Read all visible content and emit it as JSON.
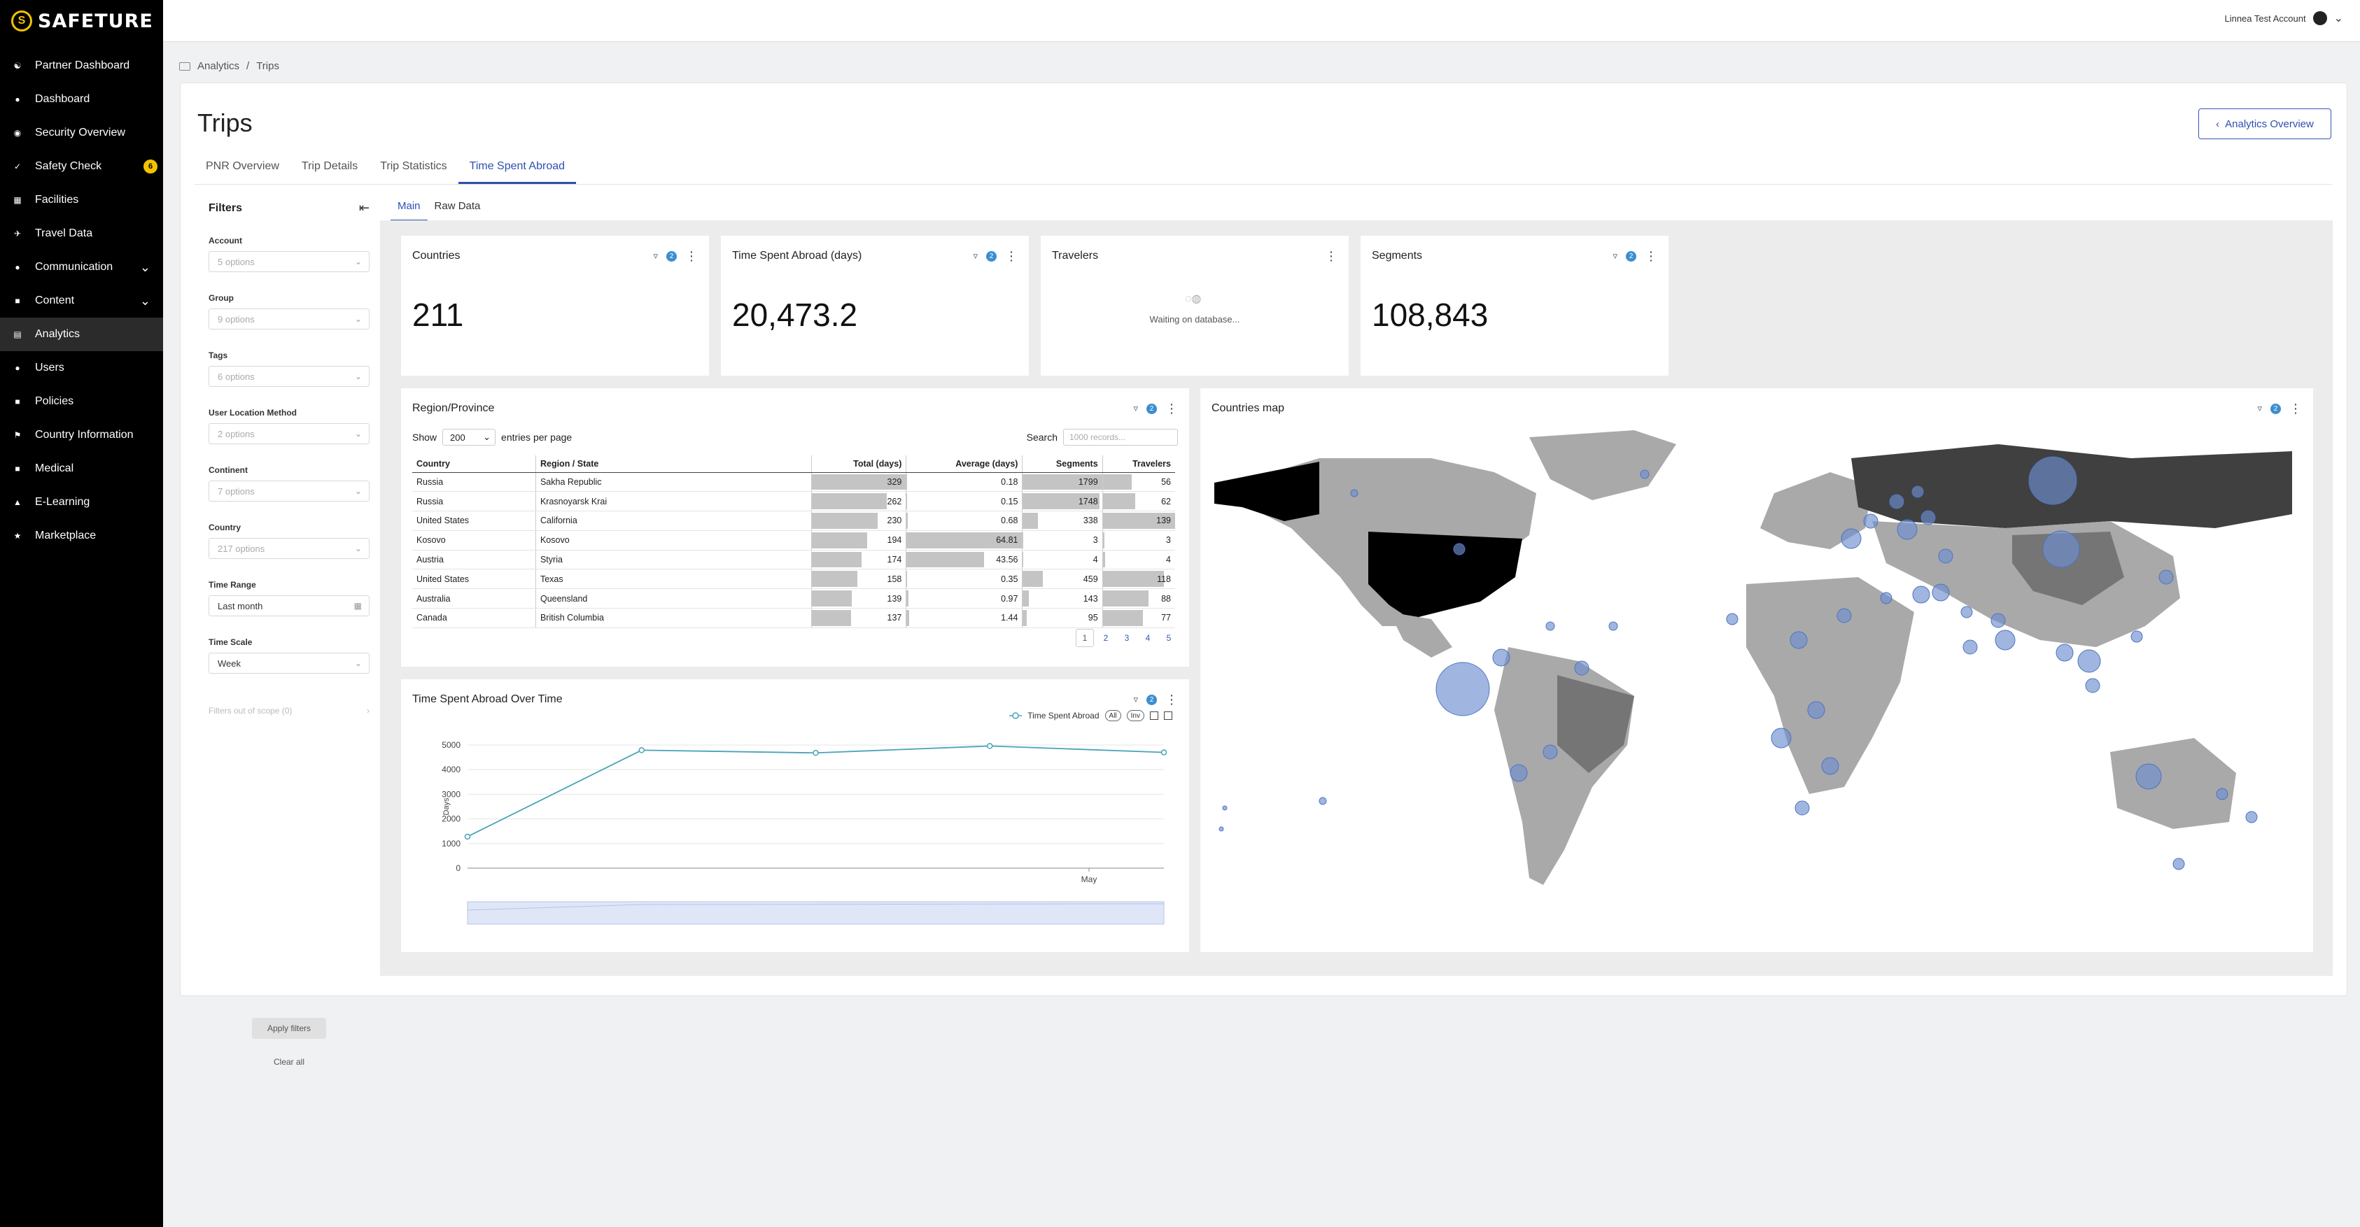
{
  "brand": {
    "name": "SAFETURE",
    "mark": "S"
  },
  "sidebar": {
    "items": [
      {
        "label": "Partner Dashboard",
        "icon": "handshake-icon"
      },
      {
        "label": "Dashboard",
        "icon": "dashboard-icon"
      },
      {
        "label": "Security Overview",
        "icon": "globe-icon"
      },
      {
        "label": "Safety Check",
        "icon": "check-icon",
        "badge": "6"
      },
      {
        "label": "Facilities",
        "icon": "building-icon"
      },
      {
        "label": "Travel Data",
        "icon": "plane-icon"
      },
      {
        "label": "Communication",
        "icon": "chat-icon",
        "expandable": true
      },
      {
        "label": "Content",
        "icon": "folder-icon",
        "expandable": true
      },
      {
        "label": "Analytics",
        "icon": "chart-icon",
        "active": true
      },
      {
        "label": "Users",
        "icon": "user-icon"
      },
      {
        "label": "Policies",
        "icon": "document-icon"
      },
      {
        "label": "Country Information",
        "icon": "flag-icon"
      },
      {
        "label": "Medical",
        "icon": "medical-icon"
      },
      {
        "label": "E-Learning",
        "icon": "graduation-icon"
      },
      {
        "label": "Marketplace",
        "icon": "store-icon"
      }
    ]
  },
  "topbar": {
    "account": "Linnea Test Account"
  },
  "breadcrumb": {
    "root": "Analytics",
    "sep": "/",
    "current": "Trips"
  },
  "page": {
    "title": "Trips",
    "overview_button": "Analytics Overview"
  },
  "tabs": [
    "PNR Overview",
    "Trip Details",
    "Trip Statistics",
    "Time Spent Abroad"
  ],
  "subtabs": [
    "Main",
    "Raw Data"
  ],
  "filters": {
    "title": "Filters",
    "fields": [
      {
        "label": "Account",
        "value": "5 options"
      },
      {
        "label": "Group",
        "value": "9 options"
      },
      {
        "label": "Tags",
        "value": "6 options"
      },
      {
        "label": "User Location Method",
        "value": "2 options"
      },
      {
        "label": "Continent",
        "value": "7 options"
      },
      {
        "label": "Country",
        "value": "217 options"
      },
      {
        "label": "Time Range",
        "value": "Last month"
      },
      {
        "label": "Time Scale",
        "value": "Week"
      }
    ],
    "out_of_scope": "Filters out of scope (0)",
    "apply": "Apply filters",
    "clear": "Clear all"
  },
  "kpis": {
    "countries": {
      "title": "Countries",
      "value": "211",
      "filter_count": "2"
    },
    "time_abroad": {
      "title": "Time Spent Abroad (days)",
      "value": "20,473.2",
      "filter_count": "2"
    },
    "travelers": {
      "title": "Travelers",
      "status": "Waiting on database..."
    },
    "segments": {
      "title": "Segments",
      "value": "108,843",
      "filter_count": "2"
    }
  },
  "region": {
    "title": "Region/Province",
    "filter_count": "2",
    "show_label": "Show",
    "show_value": "200",
    "entries_label": "entries per page",
    "search_label": "Search",
    "search_placeholder": "1000 records...",
    "columns": [
      "Country",
      "Region / State",
      "Total (days)",
      "Average (days)",
      "Segments",
      "Travelers"
    ],
    "rows": [
      [
        "Russia",
        "Sakha Republic",
        "329",
        "0.18",
        "1799",
        "56"
      ],
      [
        "Russia",
        "Krasnoyarsk Krai",
        "262",
        "0.15",
        "1748",
        "62"
      ],
      [
        "United States",
        "California",
        "230",
        "0.68",
        "338",
        "139"
      ],
      [
        "Kosovo",
        "Kosovo",
        "194",
        "64.81",
        "3",
        "3"
      ],
      [
        "Austria",
        "Styria",
        "174",
        "43.56",
        "4",
        "4"
      ],
      [
        "United States",
        "Texas",
        "158",
        "0.35",
        "459",
        "118"
      ],
      [
        "Australia",
        "Queensland",
        "139",
        "0.97",
        "143",
        "88"
      ],
      [
        "Canada",
        "British Columbia",
        "137",
        "1.44",
        "95",
        "77"
      ]
    ],
    "pages": [
      "1",
      "2",
      "3",
      "4",
      "5"
    ]
  },
  "timechart": {
    "title": "Time Spent Abroad Over Time",
    "filter_count": "2",
    "legend": "Time Spent Abroad",
    "legend_all": "All",
    "legend_inv": "Inv",
    "ylabel": "Days",
    "xtick": "May",
    "color": "#4aa3b8"
  },
  "chart_data": {
    "type": "line",
    "x": [
      "w1",
      "w2",
      "w3",
      "w4",
      "w5"
    ],
    "series": [
      {
        "name": "Time Spent Abroad",
        "values": [
          1280,
          4790,
          4680,
          4960,
          4700
        ]
      }
    ],
    "ylim": [
      0,
      5000
    ],
    "yticks": [
      "0",
      "1000",
      "2000",
      "3000",
      "4000",
      "5000"
    ],
    "ylabel": "Days",
    "xtick_labels": [
      "May"
    ],
    "grid": true
  },
  "map": {
    "title": "Countries map",
    "filter_count": "2",
    "colors": {
      "land": "#a9a9a9",
      "mid": "#757575",
      "high": "#404040",
      "top": "#000000",
      "bubble": "#6d8fd0"
    }
  }
}
